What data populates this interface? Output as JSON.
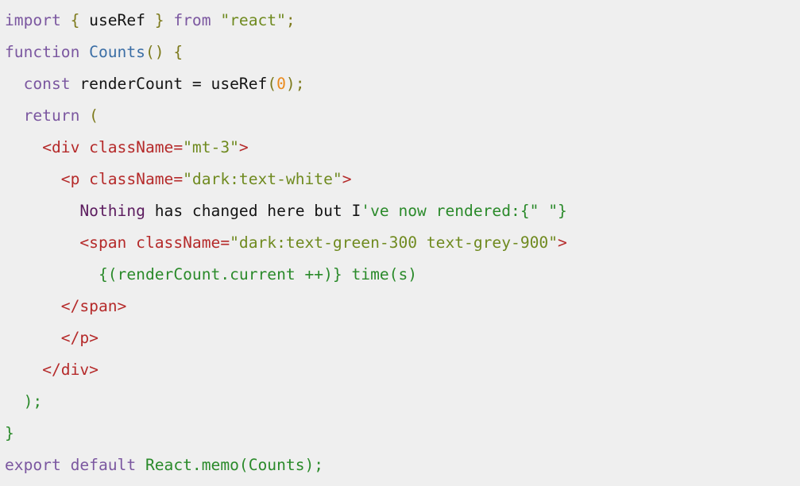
{
  "code": {
    "lines": [
      [
        {
          "t": "import",
          "c": "kw"
        },
        {
          "t": " ",
          "c": "id"
        },
        {
          "t": "{",
          "c": "pn"
        },
        {
          "t": " useRef ",
          "c": "id"
        },
        {
          "t": "}",
          "c": "pn"
        },
        {
          "t": " ",
          "c": "id"
        },
        {
          "t": "from",
          "c": "kw"
        },
        {
          "t": " ",
          "c": "id"
        },
        {
          "t": "\"react\"",
          "c": "str"
        },
        {
          "t": ";",
          "c": "pn"
        }
      ],
      [
        {
          "t": "function",
          "c": "kw"
        },
        {
          "t": " ",
          "c": "id"
        },
        {
          "t": "Counts",
          "c": "fn"
        },
        {
          "t": "()",
          "c": "pn"
        },
        {
          "t": " ",
          "c": "id"
        },
        {
          "t": "{",
          "c": "pn"
        }
      ],
      [
        {
          "t": "  ",
          "c": "id"
        },
        {
          "t": "const",
          "c": "kw"
        },
        {
          "t": " renderCount = useRef",
          "c": "id"
        },
        {
          "t": "(",
          "c": "pn"
        },
        {
          "t": "0",
          "c": "num"
        },
        {
          "t": ")",
          "c": "pn"
        },
        {
          "t": ";",
          "c": "pn"
        }
      ],
      [
        {
          "t": "  ",
          "c": "id"
        },
        {
          "t": "return",
          "c": "kw"
        },
        {
          "t": " ",
          "c": "id"
        },
        {
          "t": "(",
          "c": "pn"
        }
      ],
      [
        {
          "t": "    ",
          "c": "id"
        },
        {
          "t": "<div className=",
          "c": "tag"
        },
        {
          "t": "\"mt-3\"",
          "c": "str"
        },
        {
          "t": ">",
          "c": "tag"
        }
      ],
      [
        {
          "t": "      ",
          "c": "id"
        },
        {
          "t": "<p className=",
          "c": "tag"
        },
        {
          "t": "\"dark:text-white\"",
          "c": "str"
        },
        {
          "t": ">",
          "c": "tag"
        }
      ],
      [
        {
          "t": "        ",
          "c": "id"
        },
        {
          "t": "Nothing",
          "c": "jsx"
        },
        {
          "t": " has changed here but I",
          "c": "id"
        },
        {
          "t": "'ve now rendered:{\" \"}",
          "c": "gr"
        }
      ],
      [
        {
          "t": "        ",
          "c": "id"
        },
        {
          "t": "<span className=",
          "c": "tag"
        },
        {
          "t": "\"dark:text-green-300 text-grey-900\"",
          "c": "str"
        },
        {
          "t": ">",
          "c": "tag"
        }
      ],
      [
        {
          "t": "          ",
          "c": "id"
        },
        {
          "t": "{(renderCount.current ++)} time(s)",
          "c": "gr"
        }
      ],
      [
        {
          "t": "      ",
          "c": "id"
        },
        {
          "t": "</span>",
          "c": "tag"
        }
      ],
      [
        {
          "t": "      ",
          "c": "id"
        },
        {
          "t": "</p>",
          "c": "tag"
        }
      ],
      [
        {
          "t": "    ",
          "c": "id"
        },
        {
          "t": "</div>",
          "c": "tag"
        }
      ],
      [
        {
          "t": "  ",
          "c": "id"
        },
        {
          "t": ");",
          "c": "gr"
        }
      ],
      [
        {
          "t": "}",
          "c": "gr"
        }
      ],
      [
        {
          "t": "export",
          "c": "kw"
        },
        {
          "t": " ",
          "c": "id"
        },
        {
          "t": "default",
          "c": "kw"
        },
        {
          "t": " ",
          "c": "id"
        },
        {
          "t": "React.memo(Counts);",
          "c": "gr"
        }
      ]
    ]
  },
  "colors": {
    "background": "#efefef",
    "keyword": "#7b57a0",
    "function_name": "#3b6ea5",
    "punctuation": "#7d7a1c",
    "string": "#6f8a1f",
    "tag": "#b52a2a",
    "number": "#ea8a1d",
    "identifier": "#141414",
    "jsx_text": "#5b1b5e",
    "green_text": "#2a8a2a"
  }
}
